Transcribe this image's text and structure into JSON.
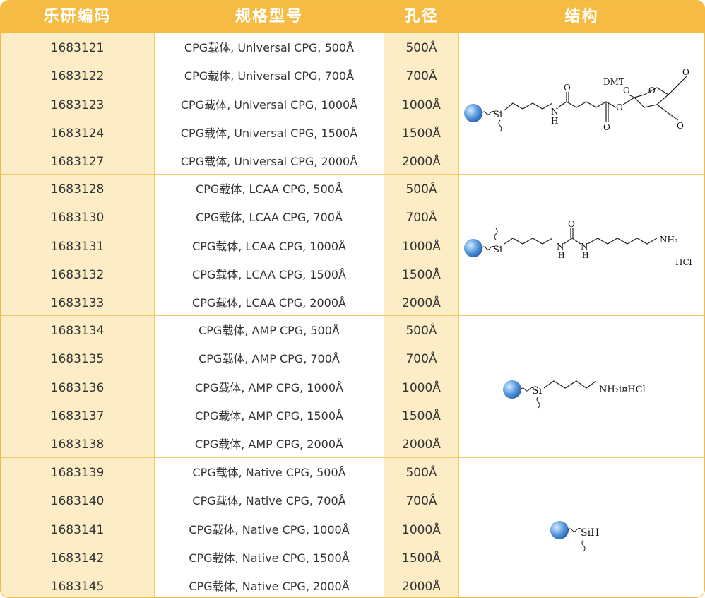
{
  "header": {
    "code": "乐研编码",
    "spec": "规格型号",
    "pore": "孔径",
    "structure": "结构"
  },
  "groups": [
    {
      "rows": [
        {
          "code": "1683121",
          "spec": "CPG载体, Universal CPG, 500Å",
          "pore": "500Å"
        },
        {
          "code": "1683122",
          "spec": "CPG载体, Universal CPG, 700Å",
          "pore": "700Å"
        },
        {
          "code": "1683123",
          "spec": "CPG载体, Universal CPG, 1000Å",
          "pore": "1000Å"
        },
        {
          "code": "1683124",
          "spec": "CPG载体, Universal CPG, 1500Å",
          "pore": "1500Å"
        },
        {
          "code": "1683127",
          "spec": "CPG载体, Universal CPG, 2000Å",
          "pore": "2000Å"
        }
      ],
      "structure_labels": {
        "si": "Si",
        "nh": "N",
        "h": "H",
        "dmt": "DMT",
        "o": "O"
      }
    },
    {
      "rows": [
        {
          "code": "1683128",
          "spec": "CPG载体, LCAA CPG, 500Å",
          "pore": "500Å"
        },
        {
          "code": "1683130",
          "spec": "CPG载体, LCAA CPG, 700Å",
          "pore": "700Å"
        },
        {
          "code": "1683131",
          "spec": "CPG载体, LCAA CPG, 1000Å",
          "pore": "1000Å"
        },
        {
          "code": "1683132",
          "spec": "CPG载体, LCAA CPG, 1500Å",
          "pore": "1500Å"
        },
        {
          "code": "1683133",
          "spec": "CPG载体, LCAA CPG, 2000Å",
          "pore": "2000Å"
        }
      ],
      "structure_labels": {
        "si": "Si",
        "n": "N",
        "h": "H",
        "o": "O",
        "nh2": "NH₂",
        "hcl": "HCl"
      }
    },
    {
      "rows": [
        {
          "code": "1683134",
          "spec": "CPG载体, AMP CPG, 500Å",
          "pore": "500Å"
        },
        {
          "code": "1683135",
          "spec": "CPG载体, AMP CPG, 700Å",
          "pore": "700Å"
        },
        {
          "code": "1683136",
          "spec": "CPG载体, AMP CPG, 1000Å",
          "pore": "1000Å"
        },
        {
          "code": "1683137",
          "spec": "CPG载体, AMP CPG, 1500Å",
          "pore": "1500Å"
        },
        {
          "code": "1683138",
          "spec": "CPG载体, AMP CPG, 2000Å",
          "pore": "2000Å"
        }
      ],
      "structure_labels": {
        "si": "Si",
        "amine": "NH₂i¤HCl"
      }
    },
    {
      "rows": [
        {
          "code": "1683139",
          "spec": "CPG载体, Native CPG, 500Å",
          "pore": "500Å"
        },
        {
          "code": "1683140",
          "spec": "CPG载体, Native CPG, 700Å",
          "pore": "700Å"
        },
        {
          "code": "1683141",
          "spec": "CPG载体, Native CPG, 1000Å",
          "pore": "1000Å"
        },
        {
          "code": "1683142",
          "spec": "CPG载体, Native CPG, 1500Å",
          "pore": "1500Å"
        },
        {
          "code": "1683145",
          "spec": "CPG载体, Native CPG, 2000Å",
          "pore": "2000Å"
        }
      ],
      "structure_labels": {
        "sih": "SiH"
      }
    }
  ],
  "colors": {
    "header_bg": "#f6bb42",
    "header_text": "#ffffff",
    "highlight_col": "#fdedc6",
    "border": "#f3c76a",
    "bead": "#5a9be0"
  }
}
